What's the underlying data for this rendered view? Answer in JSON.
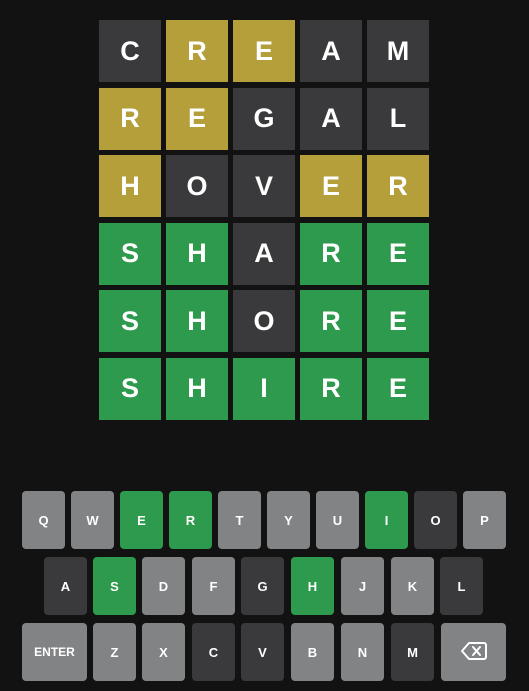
{
  "board": {
    "rows": [
      [
        {
          "letter": "C",
          "state": "absent"
        },
        {
          "letter": "R",
          "state": "present"
        },
        {
          "letter": "E",
          "state": "present"
        },
        {
          "letter": "A",
          "state": "absent"
        },
        {
          "letter": "M",
          "state": "absent"
        }
      ],
      [
        {
          "letter": "R",
          "state": "present"
        },
        {
          "letter": "E",
          "state": "present"
        },
        {
          "letter": "G",
          "state": "absent"
        },
        {
          "letter": "A",
          "state": "absent"
        },
        {
          "letter": "L",
          "state": "absent"
        }
      ],
      [
        {
          "letter": "H",
          "state": "present"
        },
        {
          "letter": "O",
          "state": "absent"
        },
        {
          "letter": "V",
          "state": "absent"
        },
        {
          "letter": "E",
          "state": "present"
        },
        {
          "letter": "R",
          "state": "present"
        }
      ],
      [
        {
          "letter": "S",
          "state": "correct"
        },
        {
          "letter": "H",
          "state": "correct"
        },
        {
          "letter": "A",
          "state": "absent"
        },
        {
          "letter": "R",
          "state": "correct"
        },
        {
          "letter": "E",
          "state": "correct"
        }
      ],
      [
        {
          "letter": "S",
          "state": "correct"
        },
        {
          "letter": "H",
          "state": "correct"
        },
        {
          "letter": "O",
          "state": "absent"
        },
        {
          "letter": "R",
          "state": "correct"
        },
        {
          "letter": "E",
          "state": "correct"
        }
      ],
      [
        {
          "letter": "S",
          "state": "correct"
        },
        {
          "letter": "H",
          "state": "correct"
        },
        {
          "letter": "I",
          "state": "correct"
        },
        {
          "letter": "R",
          "state": "correct"
        },
        {
          "letter": "E",
          "state": "correct"
        }
      ]
    ]
  },
  "keyboard": {
    "rows": [
      [
        {
          "label": "Q",
          "state": "unused"
        },
        {
          "label": "W",
          "state": "unused"
        },
        {
          "label": "E",
          "state": "correct"
        },
        {
          "label": "R",
          "state": "correct"
        },
        {
          "label": "T",
          "state": "unused"
        },
        {
          "label": "Y",
          "state": "unused"
        },
        {
          "label": "U",
          "state": "unused"
        },
        {
          "label": "I",
          "state": "correct"
        },
        {
          "label": "O",
          "state": "absent"
        },
        {
          "label": "P",
          "state": "unused"
        }
      ],
      [
        {
          "label": "A",
          "state": "absent"
        },
        {
          "label": "S",
          "state": "correct"
        },
        {
          "label": "D",
          "state": "unused"
        },
        {
          "label": "F",
          "state": "unused"
        },
        {
          "label": "G",
          "state": "absent"
        },
        {
          "label": "H",
          "state": "correct"
        },
        {
          "label": "J",
          "state": "unused"
        },
        {
          "label": "K",
          "state": "unused"
        },
        {
          "label": "L",
          "state": "absent"
        }
      ],
      [
        {
          "label": "ENTER",
          "state": "unused",
          "name": "enter-key"
        },
        {
          "label": "Z",
          "state": "unused"
        },
        {
          "label": "X",
          "state": "unused"
        },
        {
          "label": "C",
          "state": "absent"
        },
        {
          "label": "V",
          "state": "absent"
        },
        {
          "label": "B",
          "state": "unused"
        },
        {
          "label": "N",
          "state": "unused"
        },
        {
          "label": "M",
          "state": "absent"
        },
        {
          "icon": "backspace-icon",
          "state": "unused",
          "name": "backspace-key"
        }
      ]
    ]
  },
  "colors": {
    "background": "#121213",
    "correct": "#2e9a4e",
    "present": "#b59f3b",
    "absent": "#3a3a3c",
    "unused_key": "#818384",
    "text": "#ffffff"
  }
}
